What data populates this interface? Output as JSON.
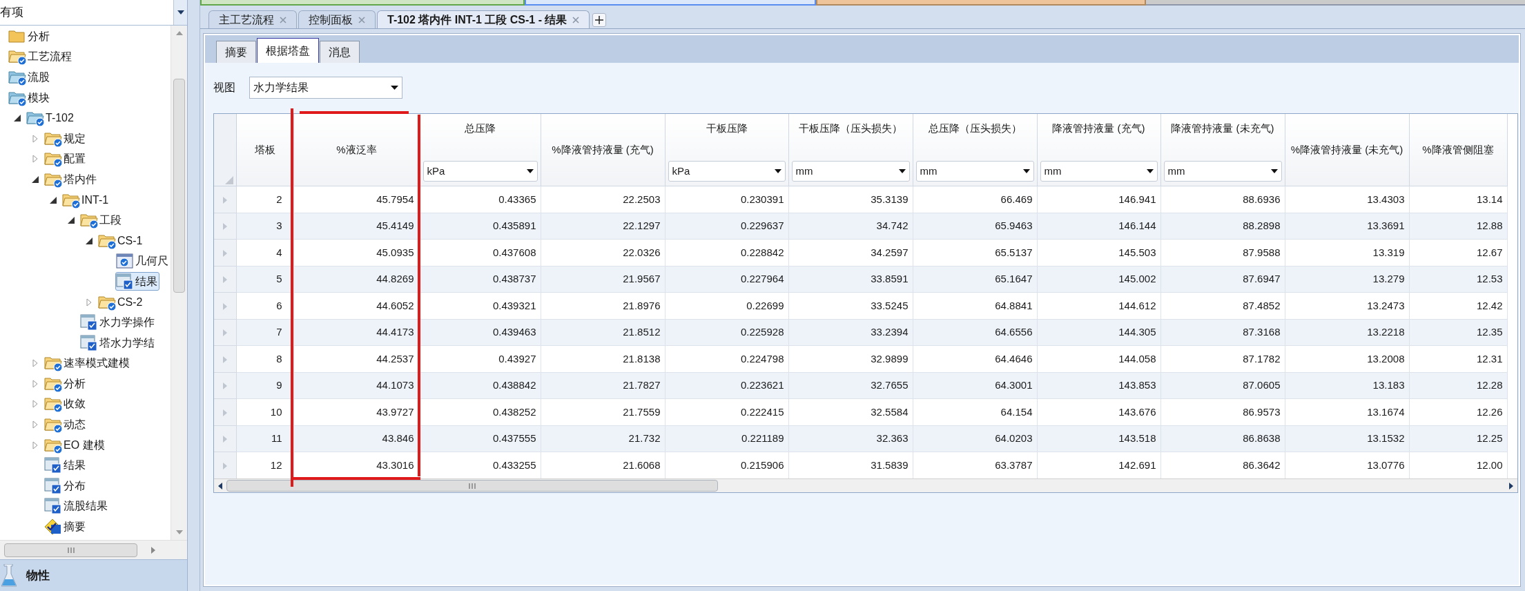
{
  "filter": {
    "value": "有项"
  },
  "tree": [
    {
      "label": "分析",
      "kind": "folder-plain",
      "selected": false
    },
    {
      "label": "工艺流程",
      "kind": "folder",
      "selected": false
    },
    {
      "label": "流股",
      "kind": "folder-blue",
      "selected": false
    },
    {
      "label": "模块",
      "kind": "folder-blue",
      "selected": false,
      "children": [
        {
          "label": "T-102",
          "kind": "folder-blue",
          "selected": false,
          "expanded": true,
          "children": [
            {
              "label": "规定",
              "kind": "folder",
              "selected": false,
              "expanded": false
            },
            {
              "label": "配置",
              "kind": "folder",
              "selected": false,
              "expanded": false
            },
            {
              "label": "塔内件",
              "kind": "folder",
              "selected": false,
              "expanded": true,
              "children": [
                {
                  "label": "INT-1",
                  "kind": "folder",
                  "selected": false,
                  "expanded": true,
                  "children": [
                    {
                      "label": "工段",
                      "kind": "folder",
                      "selected": false,
                      "expanded": true,
                      "children": [
                        {
                          "label": "CS-1",
                          "kind": "folder",
                          "selected": false,
                          "expanded": true,
                          "children": [
                            {
                              "label": "几何尺",
                              "kind": "form",
                              "selected": false
                            },
                            {
                              "label": "结果",
                              "kind": "result",
                              "selected": true
                            }
                          ]
                        },
                        {
                          "label": "CS-2",
                          "kind": "folder",
                          "selected": false,
                          "expanded": false
                        }
                      ]
                    },
                    {
                      "label": "水力学操作",
                      "kind": "result",
                      "selected": false
                    },
                    {
                      "label": "塔水力学结",
                      "kind": "result",
                      "selected": false
                    }
                  ]
                }
              ]
            },
            {
              "label": "速率模式建模",
              "kind": "folder",
              "selected": false,
              "expanded": false
            },
            {
              "label": "分析",
              "kind": "folder",
              "selected": false,
              "expanded": false
            },
            {
              "label": "收敛",
              "kind": "folder",
              "selected": false,
              "expanded": false
            },
            {
              "label": "动态",
              "kind": "folder",
              "selected": false,
              "expanded": false
            },
            {
              "label": "EO 建模",
              "kind": "folder",
              "selected": false,
              "expanded": false
            },
            {
              "label": "结果",
              "kind": "result",
              "selected": false
            },
            {
              "label": "分布",
              "kind": "result",
              "selected": false
            },
            {
              "label": "流股结果",
              "kind": "result",
              "selected": false
            },
            {
              "label": "摘要",
              "kind": "summary",
              "selected": false
            }
          ]
        }
      ]
    }
  ],
  "bottom_panel": {
    "label": "物性"
  },
  "document_tabs": [
    {
      "label": "主工艺流程",
      "selected": false
    },
    {
      "label": "控制面板",
      "selected": false
    },
    {
      "label": "T-102 塔内件 INT-1 工段 CS-1 - 结果",
      "selected": true
    }
  ],
  "tabs": [
    {
      "label": "摘要",
      "selected": false
    },
    {
      "label": "根据塔盘",
      "selected": true
    },
    {
      "label": "消息",
      "selected": false
    }
  ],
  "view": {
    "label": "视图",
    "value": "水力学结果"
  },
  "table": {
    "columns": [
      {
        "label": "塔板"
      },
      {
        "label": "%液泛率"
      },
      {
        "label": "总压降",
        "unit": "kPa"
      },
      {
        "label": "%降液管持液量 (充气)"
      },
      {
        "label": "干板压降",
        "unit": "kPa"
      },
      {
        "label": "干板压降（压头损失）",
        "unit": "mm"
      },
      {
        "label": "总压降（压头损失）",
        "unit": "mm"
      },
      {
        "label": "降液管持液量 (充气)",
        "unit": "mm"
      },
      {
        "label": "降液管持液量 (未充气)",
        "unit": "mm"
      },
      {
        "label": "%降液管持液量 (未充气)"
      },
      {
        "label": "%降液管侧阻塞"
      }
    ],
    "rows": [
      [
        "2",
        "45.7954",
        "0.43365",
        "22.2503",
        "0.230391",
        "35.3139",
        "66.469",
        "146.941",
        "88.6936",
        "13.4303",
        "13.14"
      ],
      [
        "3",
        "45.4149",
        "0.435891",
        "22.1297",
        "0.229637",
        "34.742",
        "65.9463",
        "146.144",
        "88.2898",
        "13.3691",
        "12.88"
      ],
      [
        "4",
        "45.0935",
        "0.437608",
        "22.0326",
        "0.228842",
        "34.2597",
        "65.5137",
        "145.503",
        "87.9588",
        "13.319",
        "12.67"
      ],
      [
        "5",
        "44.8269",
        "0.438737",
        "21.9567",
        "0.227964",
        "33.8591",
        "65.1647",
        "145.002",
        "87.6947",
        "13.279",
        "12.53"
      ],
      [
        "6",
        "44.6052",
        "0.439321",
        "21.8976",
        "0.22699",
        "33.5245",
        "64.8841",
        "144.612",
        "87.4852",
        "13.2473",
        "12.42"
      ],
      [
        "7",
        "44.4173",
        "0.439463",
        "21.8512",
        "0.225928",
        "33.2394",
        "64.6556",
        "144.305",
        "87.3168",
        "13.2218",
        "12.35"
      ],
      [
        "8",
        "44.2537",
        "0.43927",
        "21.8138",
        "0.224798",
        "32.9899",
        "64.4646",
        "144.058",
        "87.1782",
        "13.2008",
        "12.31"
      ],
      [
        "9",
        "44.1073",
        "0.438842",
        "21.7827",
        "0.223621",
        "32.7655",
        "64.3001",
        "143.853",
        "87.0605",
        "13.183",
        "12.28"
      ],
      [
        "10",
        "43.9727",
        "0.438252",
        "21.7559",
        "0.222415",
        "32.5584",
        "64.154",
        "143.676",
        "86.9573",
        "13.1674",
        "12.26"
      ],
      [
        "11",
        "43.846",
        "0.437555",
        "21.732",
        "0.221189",
        "32.363",
        "64.0203",
        "143.518",
        "86.8638",
        "13.1532",
        "12.25"
      ],
      [
        "12",
        "43.3016",
        "0.433255",
        "21.6068",
        "0.215906",
        "31.5839",
        "63.3787",
        "142.691",
        "86.3642",
        "13.0776",
        "12.00"
      ]
    ]
  }
}
